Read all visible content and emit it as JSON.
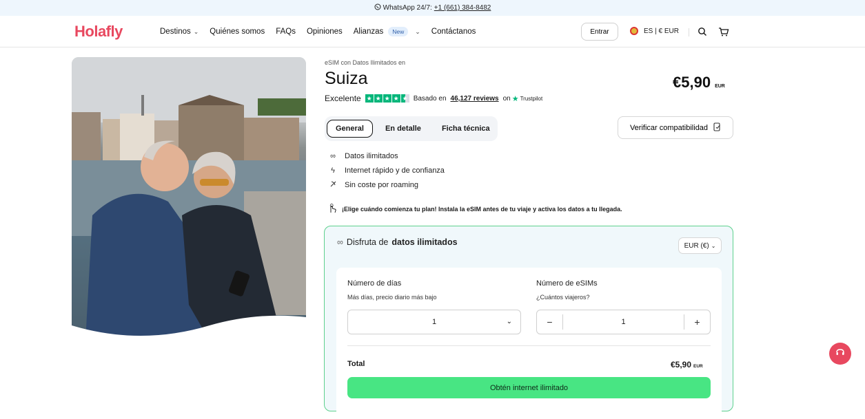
{
  "topbar": {
    "whatsapp_label": "WhatsApp 24/7:",
    "phone": "+1 (661) 384-8482"
  },
  "header": {
    "logo": "Holafly",
    "nav": [
      {
        "label": "Destinos"
      },
      {
        "label": "Quiénes somos"
      },
      {
        "label": "FAQs"
      },
      {
        "label": "Opiniones"
      },
      {
        "label": "Alianzas",
        "badge": "New"
      },
      {
        "label": "Contáctanos"
      }
    ],
    "login_label": "Entrar",
    "locale_label": "ES | € EUR"
  },
  "product": {
    "subtitle": "eSIM con Datos Ilimitados en",
    "title": "Suiza",
    "price": "€5,90",
    "price_currency": "EUR",
    "rating_word": "Excelente",
    "rating_stars": 4.5,
    "based_on": "Basado en",
    "reviews": "46,127 reviews",
    "on": "on",
    "trustpilot": "Trustpilot",
    "tabs": [
      "General",
      "En detalle",
      "Ficha técnica"
    ],
    "verify_label": "Verificar compatibilidad",
    "features": [
      "Datos ilimitados",
      "Internet rápido y de confianza",
      "Sin coste por roaming"
    ],
    "notice": "¡Elige cuándo comienza tu plan! Instala la eSIM antes de tu viaje y activa los datos a tu llegada."
  },
  "plan": {
    "head_prefix": "Disfruta de",
    "head_bold": "datos ilimitados",
    "currency_select": "EUR (€)",
    "days_label": "Número de días",
    "days_hint": "Más días, precio diario más bajo",
    "days_value": "1",
    "esims_label": "Número de eSIMs",
    "esims_hint": "¿Cuántos viajeros?",
    "esims_value": "1",
    "minus": "−",
    "plus": "+",
    "total_label": "Total",
    "total_value": "€5,90",
    "total_currency": "EUR",
    "cta": "Obtén internet ilimitado"
  },
  "colors": {
    "brand": "#e8485f",
    "cta": "#48e583",
    "card_border": "#5dd08d",
    "trustpilot": "#00b67a"
  }
}
